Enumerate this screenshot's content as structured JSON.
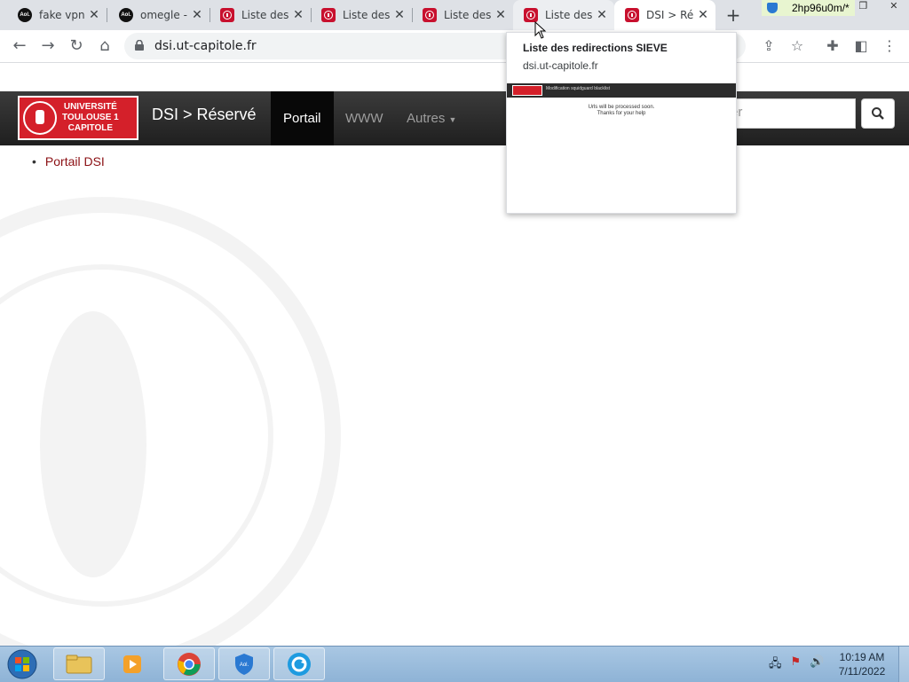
{
  "browser": {
    "tabs": [
      {
        "title": "fake vpn",
        "favicon": "aol-icon"
      },
      {
        "title": "omegle -",
        "favicon": "aol-icon"
      },
      {
        "title": "Liste des",
        "favicon": "ut-capitole-icon"
      },
      {
        "title": "Liste des",
        "favicon": "ut-capitole-icon"
      },
      {
        "title": "Liste des",
        "favicon": "ut-capitole-icon"
      },
      {
        "title": "Liste des",
        "favicon": "ut-capitole-icon"
      },
      {
        "title": "DSI > Ré",
        "favicon": "ut-capitole-icon"
      }
    ],
    "vpn_badge": "2hp96u0m/*",
    "address": "dsi.ut-capitole.fr"
  },
  "hover_card": {
    "title": "Liste des redirections SIEVE",
    "url": "dsi.ut-capitole.fr",
    "preview_header": "Modification squidguard blacklist",
    "preview_line1": "Urls will be processed soon.",
    "preview_line2": "Thanks for your help"
  },
  "site": {
    "logo_line1": "UNIVERSITÉ",
    "logo_line2": "TOULOUSE 1",
    "logo_line3": "CAPITOLE",
    "brand": "DSI > Réservé",
    "nav": [
      "Portail",
      "WWW",
      "Autres"
    ],
    "search_placeholder": "er",
    "breadcrumb": "Portail DSI",
    "accent": "#d4202a"
  },
  "taskbar": {
    "time": "10:19 AM",
    "date": "7/11/2022"
  }
}
